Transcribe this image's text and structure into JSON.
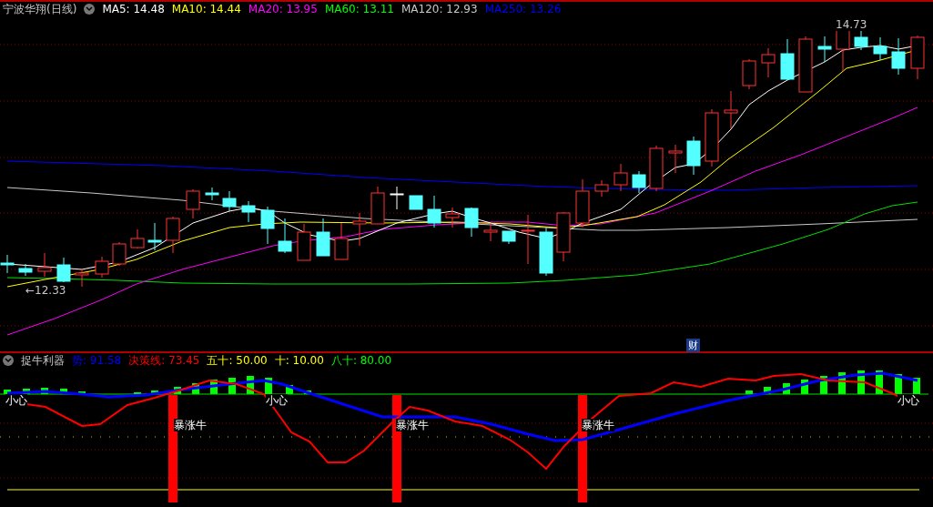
{
  "main_chart": {
    "title": "宁波华翔(日线)",
    "ma_legend": [
      {
        "text": "MA5: 14.48",
        "color": "#ffffff"
      },
      {
        "text": "MA10: 14.44",
        "color": "#ffff00"
      },
      {
        "text": "MA20: 13.95",
        "color": "#ff00ff"
      },
      {
        "text": "MA60: 13.11",
        "color": "#00ff00"
      },
      {
        "text": "MA120: 12.93",
        "color": "#c8c8c8"
      },
      {
        "text": "MA250: 13.26",
        "color": "#0000ff"
      }
    ],
    "high_label": "14.73",
    "low_label": "←12.33",
    "marker": "财"
  },
  "indicator": {
    "title": "捉牛利器",
    "legend": [
      {
        "text": "势: 91.58",
        "color": "#0000ff"
      },
      {
        "text": "决策线: 73.45",
        "color": "#ff0000"
      },
      {
        "text": "五十: 50.00",
        "color": "#ffff00"
      },
      {
        "text": "十: 10.00",
        "color": "#ffff00"
      },
      {
        "text": "八十: 80.00",
        "color": "#00ff00"
      }
    ],
    "caution_labels": [
      "小心",
      "小心",
      "小心"
    ],
    "surge_labels": [
      "暴涨牛",
      "暴涨牛",
      "暴涨牛"
    ]
  }
}
